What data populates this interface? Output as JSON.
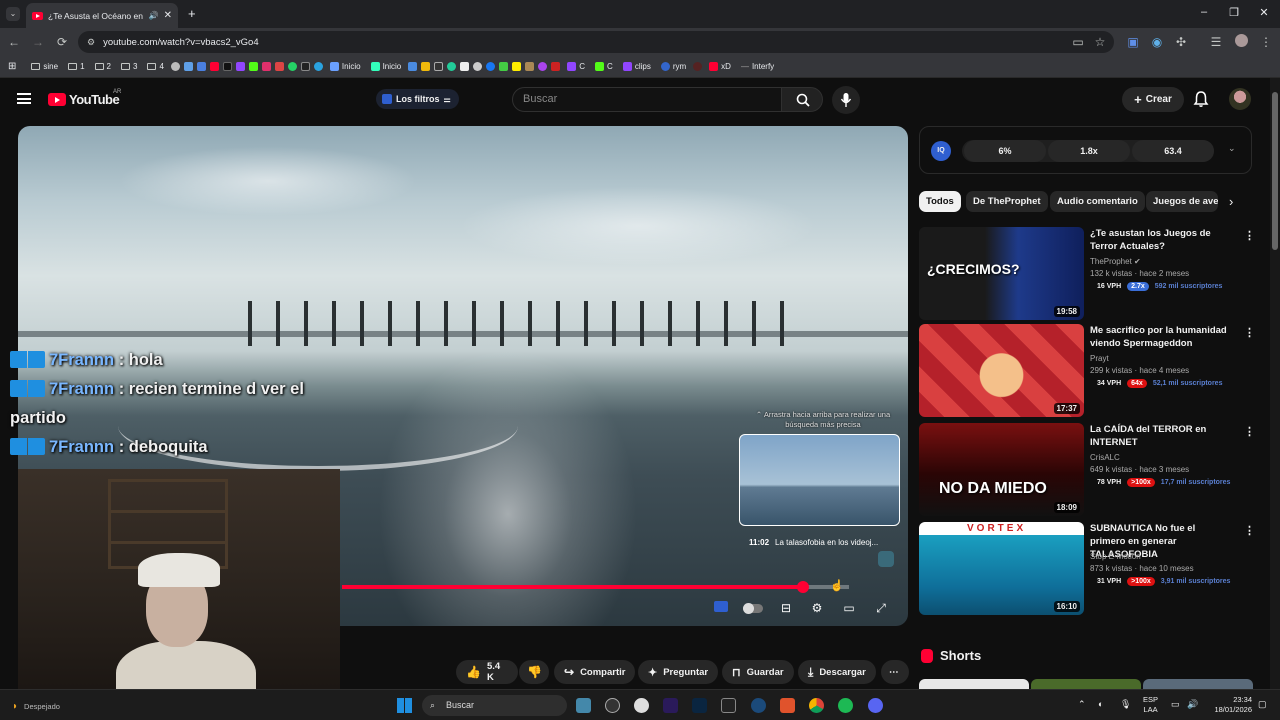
{
  "browser": {
    "tab_title": "¿Te Asusta el Océano en los Videojuegos?",
    "url": "youtube.com/watch?v=vbacs2_vGo4",
    "bookmarks": [
      {
        "label": "sine",
        "type": "folder"
      },
      {
        "label": "1",
        "type": "folder"
      },
      {
        "label": "2",
        "type": "folder"
      },
      {
        "label": "3",
        "type": "folder"
      },
      {
        "label": "4",
        "type": "folder"
      },
      {
        "label": "Inicio",
        "type": "link"
      },
      {
        "label": "Inicio",
        "type": "link"
      },
      {
        "label": "C",
        "type": "link"
      },
      {
        "label": "C",
        "type": "link"
      },
      {
        "label": "clips",
        "type": "link"
      },
      {
        "label": "rym",
        "type": "link"
      },
      {
        "label": "xD",
        "type": "link"
      },
      {
        "label": "Interfy",
        "type": "link"
      }
    ]
  },
  "youtube": {
    "logo_text": "YouTube",
    "country_code": "AR",
    "filters_label": "Los filtros",
    "search_placeholder": "Buscar",
    "create_label": "Crear"
  },
  "player": {
    "chat": [
      {
        "user": "7Frannn",
        "message": ": hola"
      },
      {
        "user": "7Frannn",
        "message": ": recien termine d ver el partido"
      },
      {
        "user": "7Frannn",
        "message": ": deboquita"
      }
    ],
    "preview_hint": "⌃ Arrastra hacia arriba para realizar una búsqueda más precisa",
    "preview_time": "11:02",
    "preview_title": "La talasofobia en los videoj...",
    "progress_played_fraction": 0.91,
    "progress_buffered_fraction": 1.0
  },
  "actions": {
    "likes": "5.4 K",
    "share": "Compartir",
    "ask": "Preguntar",
    "save": "Guardar",
    "download": "Descargar"
  },
  "iq_bar": {
    "stats": [
      "6%",
      "1.8x",
      "63.4"
    ]
  },
  "chips": [
    "Todos",
    "De TheProphet",
    "Audio comentario",
    "Juegos de aven"
  ],
  "recommendations": [
    {
      "title": "¿Te asustan los Juegos de Terror Actuales?",
      "channel": "TheProphet",
      "meta": "132 k vistas · hace 2 meses",
      "vph": "16 VPH",
      "ratio": "2.7x",
      "subs": "592 mil suscriptores",
      "duration": "19:58",
      "thumb_text": "¿CRECIMOS?"
    },
    {
      "title": "Me sacrifico por la humanidad viendo Spermageddon",
      "channel": "Prayt",
      "meta": "299 k vistas · hace 4 meses",
      "vph": "34 VPH",
      "ratio": "64x",
      "subs": "52,1 mil suscriptores",
      "duration": "17:37",
      "thumb_text": ""
    },
    {
      "title": "La CAÍDA del TERROR en INTERNET",
      "channel": "CrisALC",
      "meta": "649 k vistas · hace 3 meses",
      "vph": "78 VPH",
      "ratio": ">100x",
      "subs": "17,7 mil suscriptores",
      "duration": "18:09",
      "thumb_text": "NO DA MIEDO"
    },
    {
      "title": "SUBNAUTICA No fue el primero en generar TALASOFOBIA",
      "channel": "Stop E-Motion",
      "meta": "873 k vistas · hace 10 meses",
      "vph": "31 VPH",
      "ratio": ">100x",
      "subs": "3,91 mil suscriptores",
      "duration": "16:10",
      "thumb_text": "VORTEX"
    }
  ],
  "shorts_title": "Shorts",
  "taskbar": {
    "weather": "Despejado",
    "search": "Buscar",
    "lang_top": "ESP",
    "lang_bottom": "LAA",
    "time": "23:34",
    "date": "18/01/2026"
  },
  "colors": {
    "accent_red": "#ff0033",
    "ratio_blue": "#3a6ed8",
    "ratio_red": "#dd1111"
  }
}
